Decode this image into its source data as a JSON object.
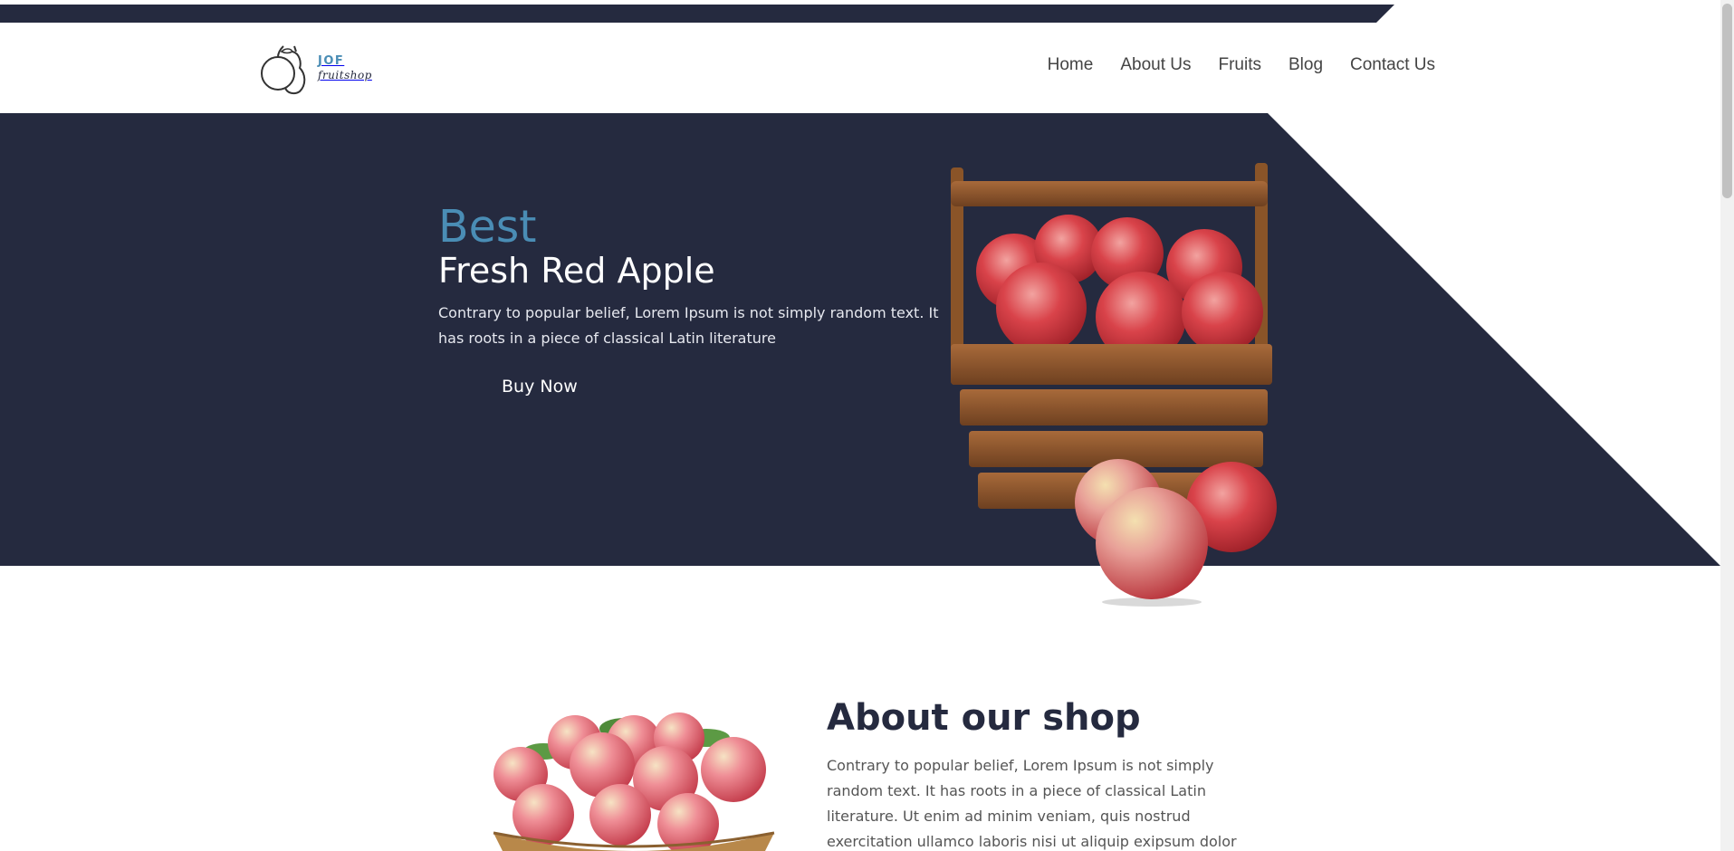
{
  "brand": {
    "name": "JOF",
    "tagline": "fruitshop"
  },
  "nav": {
    "items": [
      "Home",
      "About Us",
      "Fruits",
      "Blog",
      "Contact Us"
    ]
  },
  "hero": {
    "pretitle": "Best",
    "title": "Fresh Red Apple",
    "description": "Contrary to popular belief, Lorem Ipsum is not simply random text. It has roots in a piece of classical Latin literature",
    "button_label": "Buy Now",
    "image_icon": "apple-basket-image"
  },
  "about": {
    "title": "About our shop",
    "description": "Contrary to popular belief, Lorem Ipsum is not simply random text. It has roots in a piece of classical Latin literature. Ut enim ad minim veniam, quis nostrud exercitation ullamco laboris nisi ut aliquip exipsum dolor sit",
    "image_icon": "apple-bowl-image"
  },
  "colors": {
    "dark": "#252a3f",
    "accent": "#4a8db5",
    "white": "#ffffff"
  }
}
